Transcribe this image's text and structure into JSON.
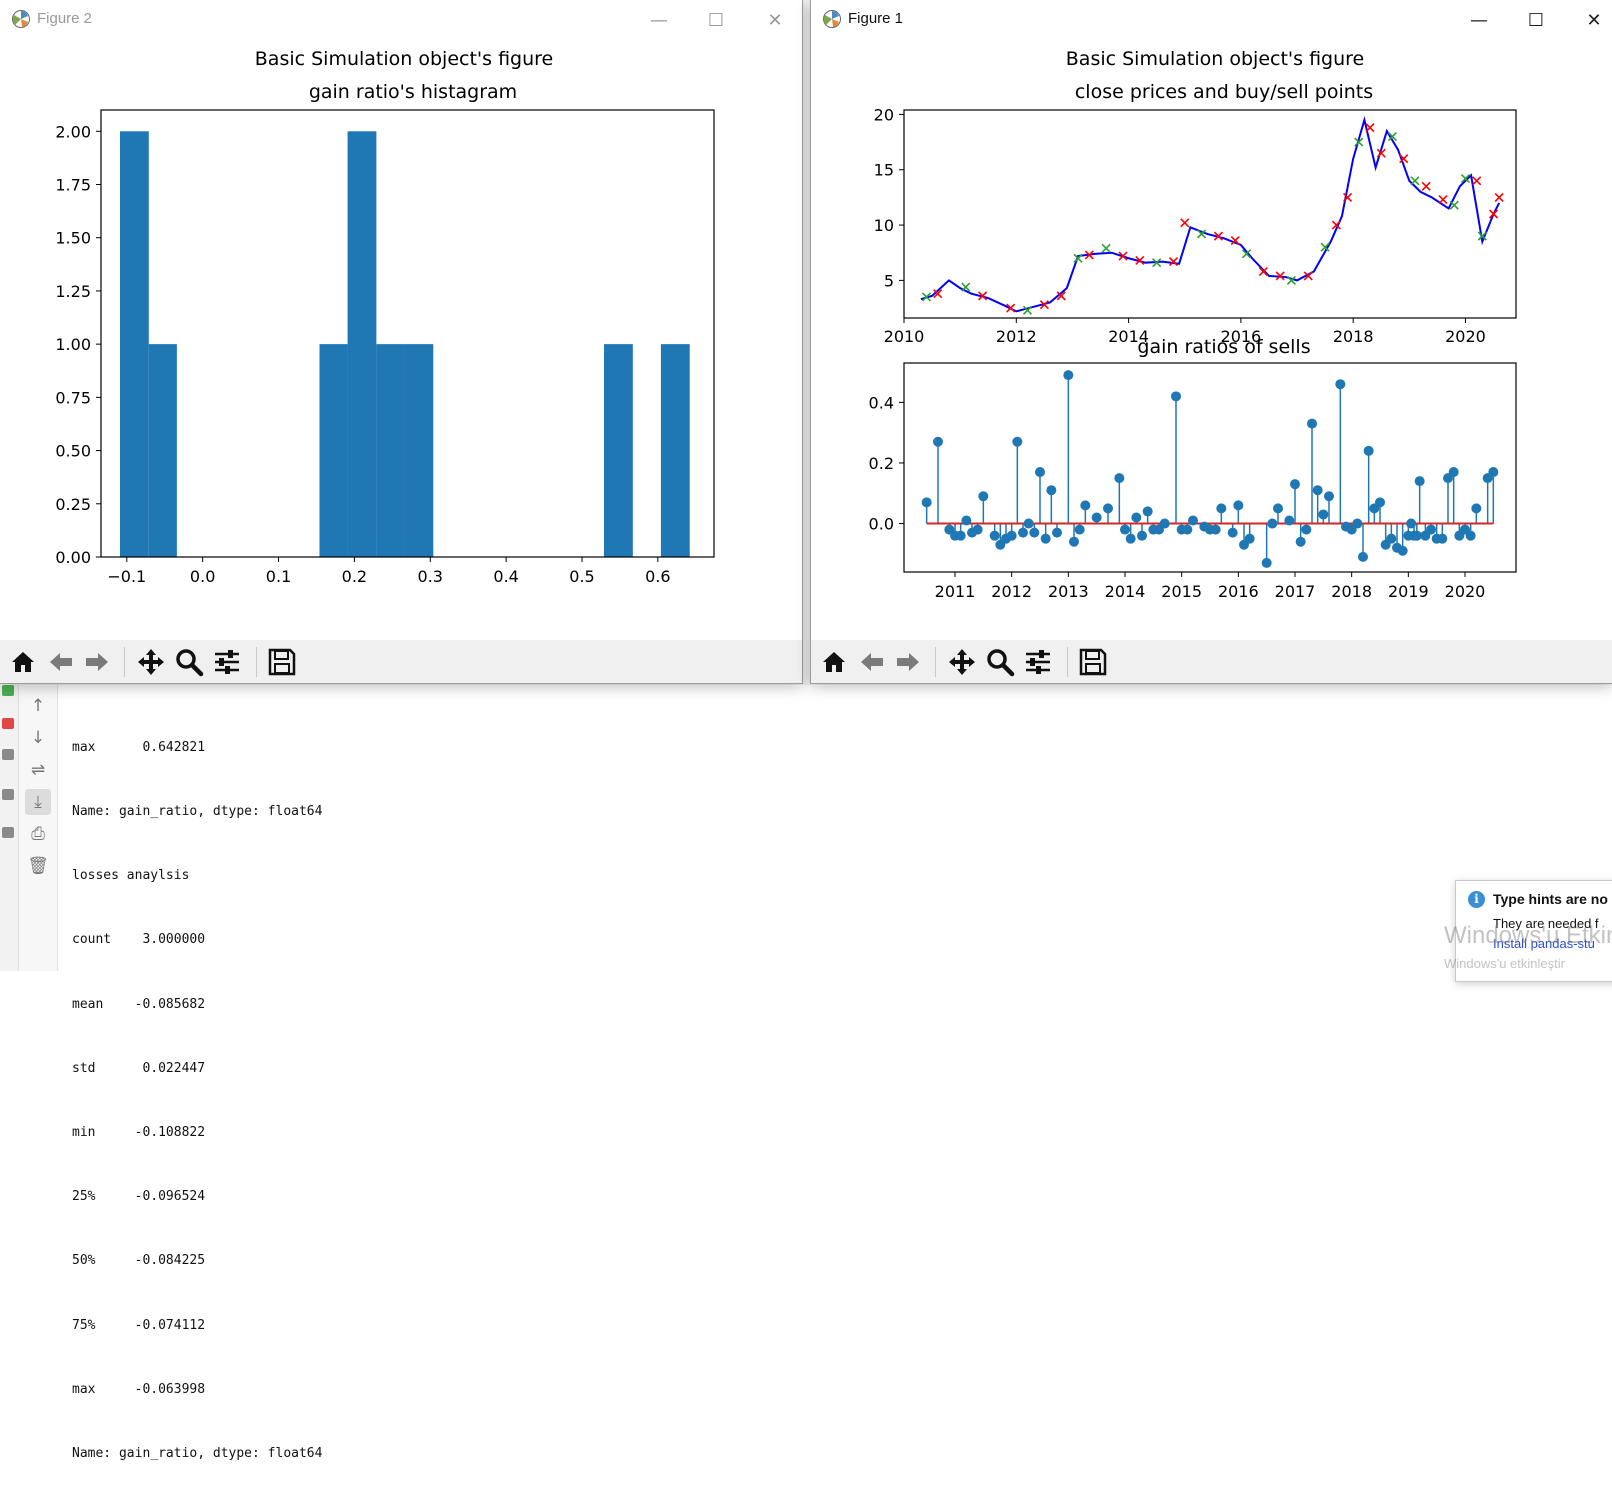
{
  "figure2": {
    "title": "Figure 2",
    "controls": {
      "minimize": "—",
      "maximize": "☐",
      "close": "✕"
    },
    "chart_data": {
      "type": "bar",
      "title": "Basic Simulation object's figure",
      "subtitle": "gain ratio's histagram",
      "xlim": [
        -0.134,
        0.674
      ],
      "ylim": [
        0,
        2.1
      ],
      "xticks": [
        "−0.1",
        "0.0",
        "0.1",
        "0.2",
        "0.3",
        "0.4",
        "0.5",
        "0.6"
      ],
      "xtick_values": [
        -0.1,
        0.0,
        0.1,
        0.2,
        0.3,
        0.4,
        0.5,
        0.6
      ],
      "yticks": [
        "0.00",
        "0.25",
        "0.50",
        "0.75",
        "1.00",
        "1.25",
        "1.50",
        "1.75",
        "2.00"
      ],
      "ytick_values": [
        0,
        0.25,
        0.5,
        0.75,
        1.0,
        1.25,
        1.5,
        1.75,
        2.0
      ],
      "bins": [
        {
          "x0": -0.109,
          "x1": -0.071,
          "count": 2
        },
        {
          "x0": -0.071,
          "x1": -0.034,
          "count": 1
        },
        {
          "x0": 0.154,
          "x1": 0.191,
          "count": 1
        },
        {
          "x0": 0.191,
          "x1": 0.229,
          "count": 2
        },
        {
          "x0": 0.229,
          "x1": 0.266,
          "count": 1
        },
        {
          "x0": 0.266,
          "x1": 0.304,
          "count": 1
        },
        {
          "x0": 0.529,
          "x1": 0.567,
          "count": 1
        },
        {
          "x0": 0.604,
          "x1": 0.642,
          "count": 1
        }
      ],
      "color": "#1f77b4"
    }
  },
  "figure1": {
    "title": "Figure 1",
    "controls": {
      "minimize": "—",
      "maximize": "☐",
      "close": "✕"
    },
    "chart_data": [
      {
        "type": "line",
        "title": "Basic Simulation object's figure",
        "subtitle": "close prices and buy/sell points",
        "xlim": [
          2010.0,
          2020.9
        ],
        "ylim": [
          1.6,
          20.4
        ],
        "xticks": [
          "2010",
          "2012",
          "2014",
          "2016",
          "2018",
          "2020"
        ],
        "xtick_values": [
          2010,
          2012,
          2014,
          2016,
          2018,
          2020
        ],
        "yticks": [
          "5",
          "10",
          "15",
          "20"
        ],
        "ytick_values": [
          5,
          10,
          15,
          20
        ],
        "line_color": "#0000ff",
        "buy_color": "#2ca02c",
        "sell_color": "#ff0000",
        "x": [
          2010.3,
          2010.5,
          2010.8,
          2011.0,
          2011.2,
          2011.5,
          2011.8,
          2012.0,
          2012.3,
          2012.6,
          2012.9,
          2013.1,
          2013.4,
          2013.7,
          2014.0,
          2014.3,
          2014.6,
          2014.9,
          2015.1,
          2015.4,
          2015.7,
          2016.0,
          2016.2,
          2016.5,
          2016.8,
          2017.0,
          2017.3,
          2017.6,
          2017.8,
          2018.0,
          2018.2,
          2018.4,
          2018.6,
          2018.8,
          2019.0,
          2019.2,
          2019.4,
          2019.7,
          2019.9,
          2020.1,
          2020.3,
          2020.5,
          2020.6
        ],
        "y": [
          3.3,
          3.6,
          5.0,
          4.3,
          3.8,
          3.4,
          2.7,
          2.2,
          2.6,
          3.0,
          4.3,
          7.2,
          7.4,
          7.5,
          7.0,
          6.6,
          6.7,
          6.5,
          9.8,
          9.2,
          8.8,
          8.2,
          7.0,
          5.4,
          5.3,
          5.0,
          5.8,
          8.5,
          10.8,
          16.0,
          19.5,
          15.2,
          18.5,
          16.8,
          14.0,
          13.0,
          12.5,
          11.5,
          13.5,
          14.5,
          8.5,
          11.0,
          12.0
        ],
        "markers": [
          {
            "x": 2010.4,
            "y": 3.5,
            "kind": "buy"
          },
          {
            "x": 2010.6,
            "y": 3.8,
            "kind": "sell"
          },
          {
            "x": 2011.1,
            "y": 4.4,
            "kind": "buy"
          },
          {
            "x": 2011.4,
            "y": 3.6,
            "kind": "sell"
          },
          {
            "x": 2011.9,
            "y": 2.5,
            "kind": "sell"
          },
          {
            "x": 2012.2,
            "y": 2.3,
            "kind": "buy"
          },
          {
            "x": 2012.5,
            "y": 2.8,
            "kind": "sell"
          },
          {
            "x": 2012.8,
            "y": 3.6,
            "kind": "sell"
          },
          {
            "x": 2013.1,
            "y": 7.0,
            "kind": "buy"
          },
          {
            "x": 2013.3,
            "y": 7.3,
            "kind": "sell"
          },
          {
            "x": 2013.6,
            "y": 7.9,
            "kind": "buy"
          },
          {
            "x": 2013.9,
            "y": 7.2,
            "kind": "sell"
          },
          {
            "x": 2014.2,
            "y": 6.8,
            "kind": "sell"
          },
          {
            "x": 2014.5,
            "y": 6.6,
            "kind": "buy"
          },
          {
            "x": 2014.8,
            "y": 6.7,
            "kind": "sell"
          },
          {
            "x": 2015.0,
            "y": 10.2,
            "kind": "sell"
          },
          {
            "x": 2015.3,
            "y": 9.2,
            "kind": "buy"
          },
          {
            "x": 2015.6,
            "y": 9.0,
            "kind": "sell"
          },
          {
            "x": 2015.9,
            "y": 8.6,
            "kind": "sell"
          },
          {
            "x": 2016.1,
            "y": 7.4,
            "kind": "buy"
          },
          {
            "x": 2016.4,
            "y": 5.8,
            "kind": "sell"
          },
          {
            "x": 2016.7,
            "y": 5.4,
            "kind": "sell"
          },
          {
            "x": 2016.9,
            "y": 5.0,
            "kind": "buy"
          },
          {
            "x": 2017.2,
            "y": 5.4,
            "kind": "sell"
          },
          {
            "x": 2017.5,
            "y": 8.0,
            "kind": "buy"
          },
          {
            "x": 2017.7,
            "y": 10.0,
            "kind": "sell"
          },
          {
            "x": 2017.9,
            "y": 12.5,
            "kind": "sell"
          },
          {
            "x": 2018.1,
            "y": 17.5,
            "kind": "buy"
          },
          {
            "x": 2018.3,
            "y": 18.8,
            "kind": "sell"
          },
          {
            "x": 2018.5,
            "y": 16.5,
            "kind": "sell"
          },
          {
            "x": 2018.7,
            "y": 18.0,
            "kind": "buy"
          },
          {
            "x": 2018.9,
            "y": 16.0,
            "kind": "sell"
          },
          {
            "x": 2019.1,
            "y": 14.0,
            "kind": "buy"
          },
          {
            "x": 2019.3,
            "y": 13.5,
            "kind": "sell"
          },
          {
            "x": 2019.6,
            "y": 12.3,
            "kind": "sell"
          },
          {
            "x": 2019.8,
            "y": 11.8,
            "kind": "buy"
          },
          {
            "x": 2020.0,
            "y": 14.2,
            "kind": "buy"
          },
          {
            "x": 2020.2,
            "y": 14.0,
            "kind": "sell"
          },
          {
            "x": 2020.3,
            "y": 9.0,
            "kind": "buy"
          },
          {
            "x": 2020.5,
            "y": 11.0,
            "kind": "sell"
          },
          {
            "x": 2020.6,
            "y": 12.5,
            "kind": "sell"
          }
        ]
      },
      {
        "type": "stem",
        "title": "gain ratios of sells",
        "xlim": [
          2010.1,
          2020.9
        ],
        "ylim": [
          -0.16,
          0.53
        ],
        "xticks": [
          "2011",
          "2012",
          "2013",
          "2014",
          "2015",
          "2016",
          "2017",
          "2018",
          "2019",
          "2020"
        ],
        "xtick_values": [
          2011,
          2012,
          2013,
          2014,
          2015,
          2016,
          2017,
          2018,
          2019,
          2020
        ],
        "yticks": [
          "0.0",
          "0.2",
          "0.4"
        ],
        "ytick_values": [
          0.0,
          0.2,
          0.4
        ],
        "baseline_color": "#d62728",
        "marker_color": "#1f77b4",
        "x": [
          2010.5,
          2010.7,
          2010.9,
          2011.0,
          2011.1,
          2011.2,
          2011.3,
          2011.4,
          2011.5,
          2011.7,
          2011.8,
          2011.9,
          2012.0,
          2012.1,
          2012.2,
          2012.3,
          2012.4,
          2012.5,
          2012.6,
          2012.7,
          2012.8,
          2013.0,
          2013.1,
          2013.2,
          2013.3,
          2013.5,
          2013.7,
          2013.9,
          2014.0,
          2014.1,
          2014.2,
          2014.3,
          2014.4,
          2014.5,
          2014.6,
          2014.7,
          2014.9,
          2015.0,
          2015.1,
          2015.2,
          2015.4,
          2015.5,
          2015.6,
          2015.7,
          2015.9,
          2016.0,
          2016.1,
          2016.2,
          2016.5,
          2016.6,
          2016.7,
          2016.9,
          2017.0,
          2017.1,
          2017.2,
          2017.3,
          2017.4,
          2017.5,
          2017.6,
          2017.8,
          2017.9,
          2018.0,
          2018.1,
          2018.2,
          2018.3,
          2018.4,
          2018.5,
          2018.6,
          2018.7,
          2018.8,
          2018.9,
          2019.0,
          2019.05,
          2019.1,
          2019.15,
          2019.2,
          2019.3,
          2019.4,
          2019.5,
          2019.6,
          2019.7,
          2019.8,
          2019.9,
          2020.0,
          2020.1,
          2020.2,
          2020.4,
          2020.5
        ],
        "y": [
          0.07,
          0.27,
          -0.02,
          -0.04,
          -0.04,
          0.01,
          -0.03,
          -0.02,
          0.09,
          -0.04,
          -0.07,
          -0.05,
          -0.04,
          0.27,
          -0.03,
          0.0,
          -0.03,
          0.17,
          -0.05,
          0.11,
          -0.03,
          0.49,
          -0.06,
          -0.02,
          0.06,
          0.02,
          0.05,
          0.15,
          -0.02,
          -0.05,
          0.02,
          -0.04,
          0.04,
          -0.02,
          -0.02,
          0.0,
          0.42,
          -0.02,
          -0.02,
          0.01,
          -0.01,
          -0.02,
          -0.02,
          0.05,
          -0.03,
          0.06,
          -0.07,
          -0.05,
          -0.13,
          0.0,
          0.05,
          0.01,
          0.13,
          -0.06,
          -0.02,
          0.33,
          0.11,
          0.03,
          0.09,
          0.46,
          -0.01,
          -0.02,
          0.0,
          -0.11,
          0.24,
          0.05,
          0.07,
          -0.07,
          -0.05,
          -0.08,
          -0.09,
          -0.04,
          0.0,
          -0.04,
          -0.04,
          0.14,
          -0.04,
          -0.02,
          -0.05,
          -0.05,
          0.15,
          0.17,
          -0.04,
          -0.02,
          -0.04,
          0.05,
          0.15,
          0.17
        ]
      }
    ]
  },
  "toolbar": {
    "tools": [
      "home",
      "back",
      "forward",
      "pan",
      "zoom",
      "configure",
      "save"
    ]
  },
  "console": {
    "lines": [
      "max      0.642821",
      "Name: gain_ratio, dtype: float64",
      "losses anaylsis",
      "count    3.000000",
      "mean    -0.085682",
      "std      0.022447",
      "min     -0.108822",
      "25%     -0.096524",
      "50%     -0.084225",
      "75%     -0.074112",
      "max     -0.063998",
      "Name: gain_ratio, dtype: float64"
    ]
  },
  "notification": {
    "icon": "i",
    "title": "Type hints are no",
    "body": "They are needed f",
    "link": "Install pandas-stu"
  },
  "watermark": {
    "line1": "Windows'u Etkin",
    "line2": "Windows'u etkinleştir"
  }
}
